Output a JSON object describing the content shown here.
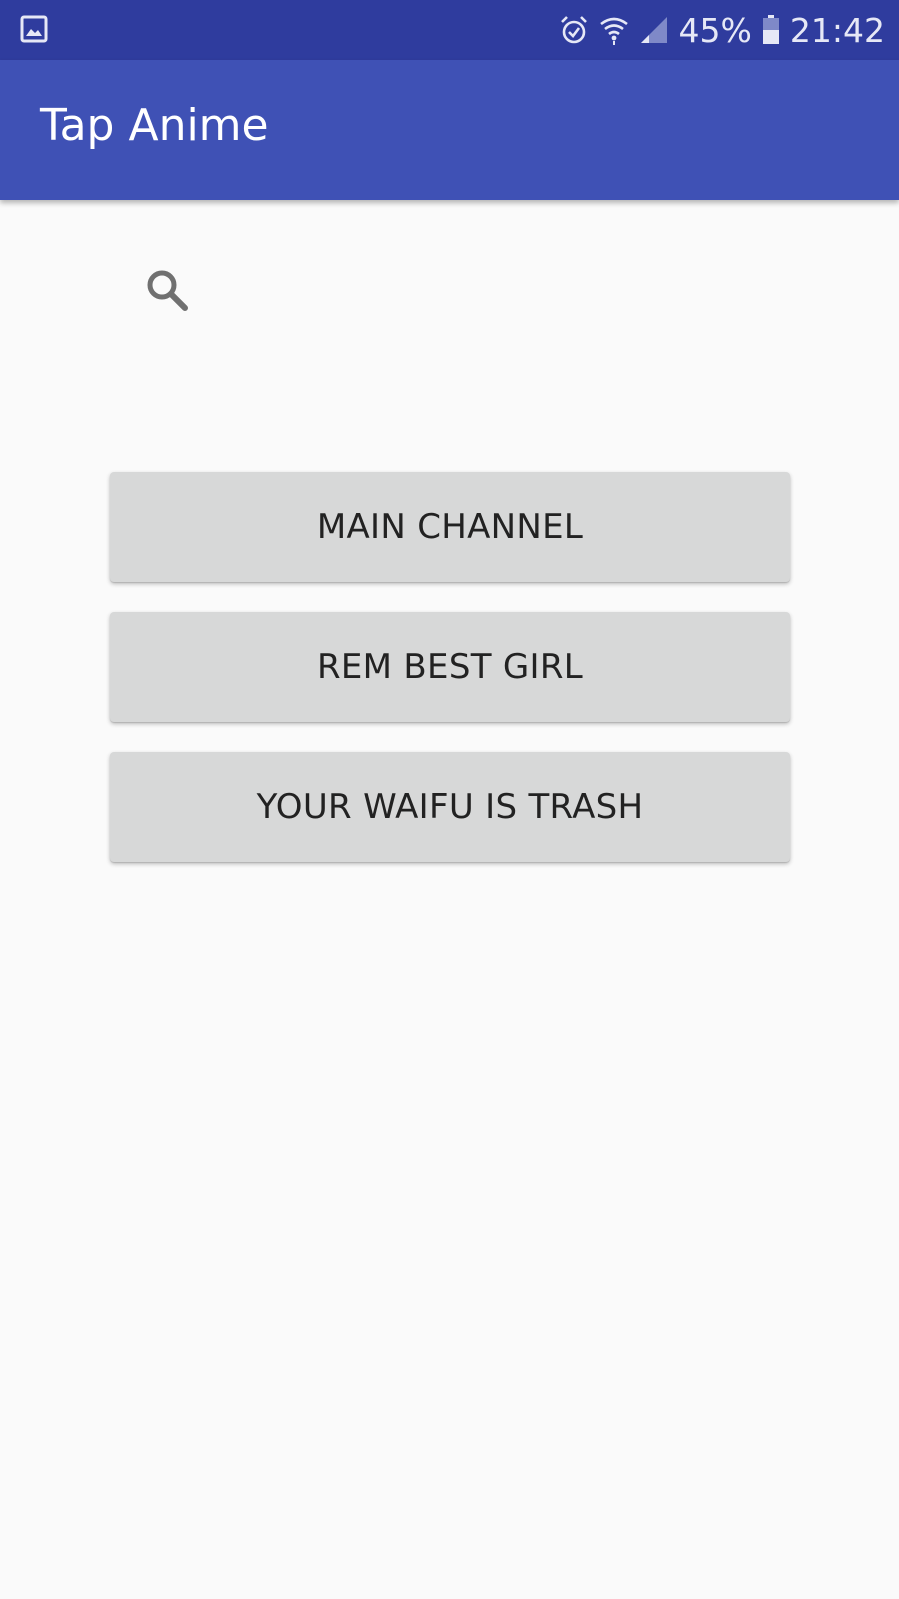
{
  "status_bar": {
    "battery_percent": "45%",
    "time": "21:42",
    "icons": [
      "gallery-notification-icon",
      "alarm-icon",
      "wifi-icon",
      "cellular-signal-icon",
      "battery-icon"
    ]
  },
  "app_bar": {
    "title": "Tap Anime"
  },
  "search": {
    "icon": "search-icon"
  },
  "buttons": [
    {
      "label": "MAIN CHANNEL"
    },
    {
      "label": "REM BEST GIRL"
    },
    {
      "label": "YOUR WAIFU IS TRASH"
    }
  ],
  "colors": {
    "status_bar": "#2f3c9e",
    "app_bar": "#3f51b5",
    "background": "#fafafa",
    "button": "#d7d8d8",
    "button_text": "#222222"
  }
}
